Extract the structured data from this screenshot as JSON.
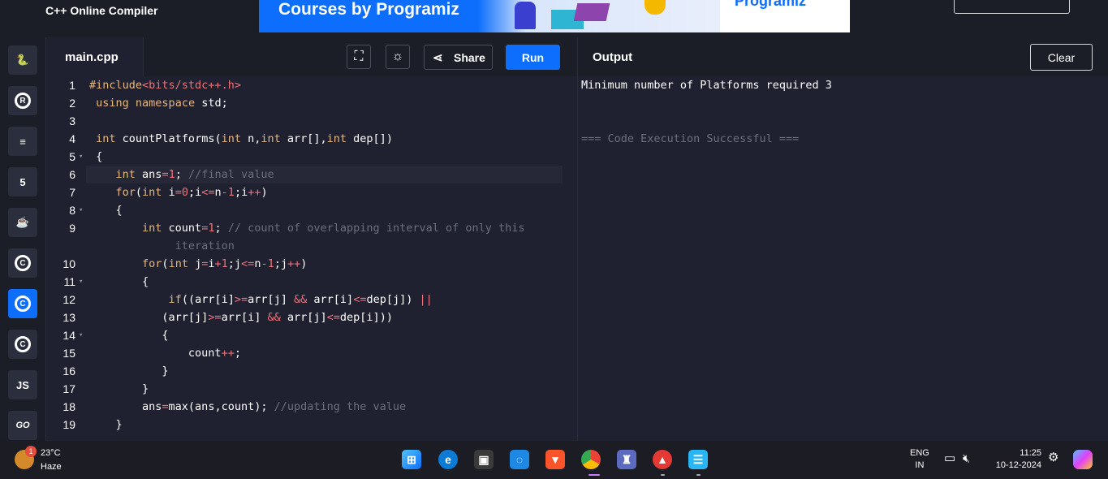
{
  "header": {
    "title": "C++ Online Compiler",
    "banner_text": "Courses by Programiz",
    "banner_brand": "Programiz"
  },
  "sidebar": {
    "items": [
      {
        "name": "python",
        "label": "🐍"
      },
      {
        "name": "r",
        "label": "R"
      },
      {
        "name": "sql",
        "label": "≡"
      },
      {
        "name": "html",
        "label": "5"
      },
      {
        "name": "java",
        "label": "☕"
      },
      {
        "name": "c",
        "label": "C"
      },
      {
        "name": "cpp",
        "label": "C"
      },
      {
        "name": "csharp",
        "label": "C"
      },
      {
        "name": "javascript",
        "label": "JS"
      },
      {
        "name": "go",
        "label": "GO"
      }
    ]
  },
  "editor": {
    "tab": "main.cpp",
    "share_label": "Share",
    "run_label": "Run",
    "line_numbers": [
      "1",
      "2",
      "3",
      "4",
      "5",
      "6",
      "7",
      "8",
      "9",
      "",
      "10",
      "11",
      "12",
      "13",
      "14",
      "15",
      "16",
      "17",
      "18",
      "19"
    ]
  },
  "output": {
    "title": "Output",
    "clear_label": "Clear",
    "result_line": "Minimum number of Platforms required 3",
    "status_line": "=== Code Execution Successful ==="
  },
  "taskbar": {
    "weather_badge": "1",
    "temperature": "23°C",
    "condition": "Haze",
    "lang_top": "ENG",
    "lang_bottom": "IN",
    "time": "11:25",
    "date": "10-12-2024"
  },
  "colors": {
    "accent": "#0d6efd",
    "keyword": "#e4b781",
    "operator": "#f07178",
    "comment": "#6b6f7e",
    "background": "#1f2130"
  }
}
